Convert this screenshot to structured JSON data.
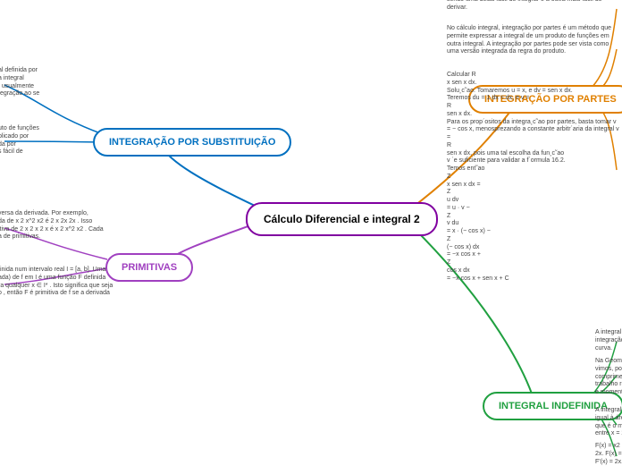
{
  "center": {
    "label": "Cálculo Diferencial e integral 2"
  },
  "nodes": {
    "substituicao": {
      "label": "INTEGRAÇÃO POR SUBSTITUIÇÃO"
    },
    "primitivas": {
      "label": "PRIMITIVAS"
    },
    "partes": {
      "label": "INTEGRAÇÃO POR PARTES"
    },
    "indefinida": {
      "label": "INTEGRAL INDEFINIDA"
    }
  },
  "texts": {
    "sub1": "al definida por\na integral\n, usualmente\ntegração ao se",
    "sub2": "uto de funções\nplicado por\nda por\ns fácil de",
    "prim1": "versa da derivada. Por exemplo,\nda de x 2 x^2 x2 é 2 x 2x 2x . Isso\nitiva de 2 x 2 x 2 x é x 2 x^2 x2 . Cada\na de primitivas.",
    "prim2": "finida num intervalo real I = [a, b]. Uma\n ada) de f em I é uma função F definida\nra qualquer x ∈ I* . Isto significa que seja\no , então F é primitiva de f se a derivada",
    "partes0": "sendo uma delas fácil de integrar e a outra mais fácil de derivar.",
    "partes1": "No cálculo integral, integração por partes é um método que permite expressar a integral de um produto de funções em outra integral. A integração por partes pode ser vista como uma versão integrada da regra do produto.",
    "partes2": "Calcular R\nx sen x dx.\nSolu¸c˜ao. Tomaremos u = x, e dv = sen x dx.\nTeremos du = 1 dx = dx, e v =\nR\nsen x dx.\nPara os prop´ositos da integra¸c˜ao por partes, basta tomar v = − cos x, menosprezando a constante arbitr´aria da integral v =\nR\nsen x dx, pois uma tal escolha da fun¸c˜ao\nv ´e suficiente para validar a f´ormula 16.2.\nTemos ent˜ao\nZ\nx sen x dx =\nZ\nu dv\n= u · v −\nZ\nv du\n= x · (− cos x) −\nZ\n(− cos x) dx\n= −x cos x +\nZ\ncos x dx\n= −x cos x + sen x + C",
    "ind1": "A integral in\nintegração e\ncurva.",
    "ind2": "Na Geomet\nvimos, pode\ncompriment\ntrabalho rea\ne momento",
    "ind3": "A integral d\nigual à área\nque é o mes\nentre x = 2",
    "ind4": "F(x) = x2 é u\n2x. F(x) = x2\nF'(x) = 2x. F"
  }
}
